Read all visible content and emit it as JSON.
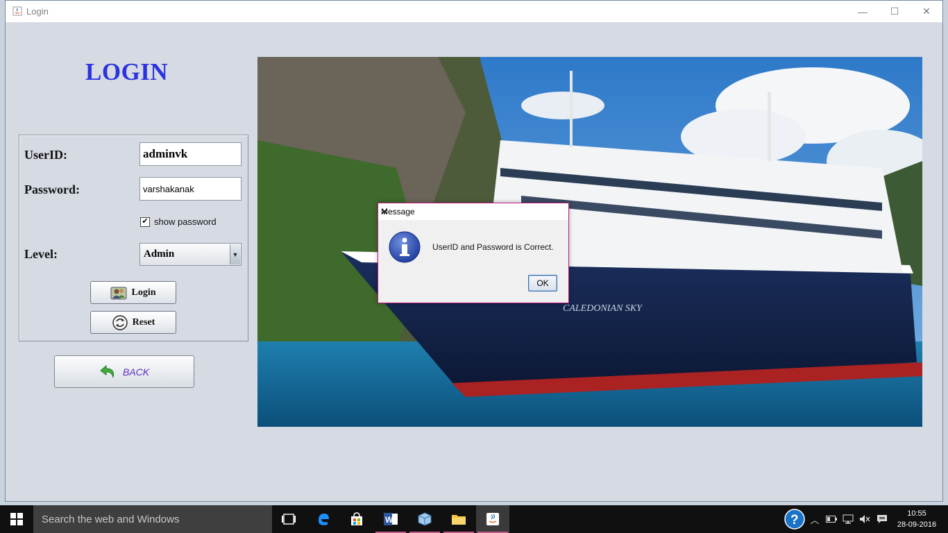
{
  "window": {
    "title": "Login"
  },
  "titlebar": {
    "minimize": "—",
    "maximize": "☐",
    "close": "✕"
  },
  "form": {
    "heading": "LOGIN",
    "userid_label": "UserID:",
    "userid_value": "adminvk",
    "password_label": "Password:",
    "password_value": "varshakanak",
    "show_password_label": "show password",
    "show_password_checked": true,
    "level_label": "Level:",
    "level_value": "Admin",
    "login_button": "Login",
    "reset_button": "Reset",
    "back_button": "BACK"
  },
  "dialog": {
    "title": "Message",
    "message": "UserID and Password is Correct.",
    "ok_button": "OK"
  },
  "taskbar": {
    "search_placeholder": "Search the web and Windows",
    "time": "10:55",
    "date": "28-09-2016",
    "apps": [
      "task-view",
      "edge",
      "store",
      "word",
      "virtualbox",
      "file-explorer",
      "java"
    ]
  },
  "colors": {
    "heading": "#2b33e0",
    "back_text": "#5a2fc0",
    "dialog_border": "#c2187c",
    "taskbar": "#101010"
  }
}
